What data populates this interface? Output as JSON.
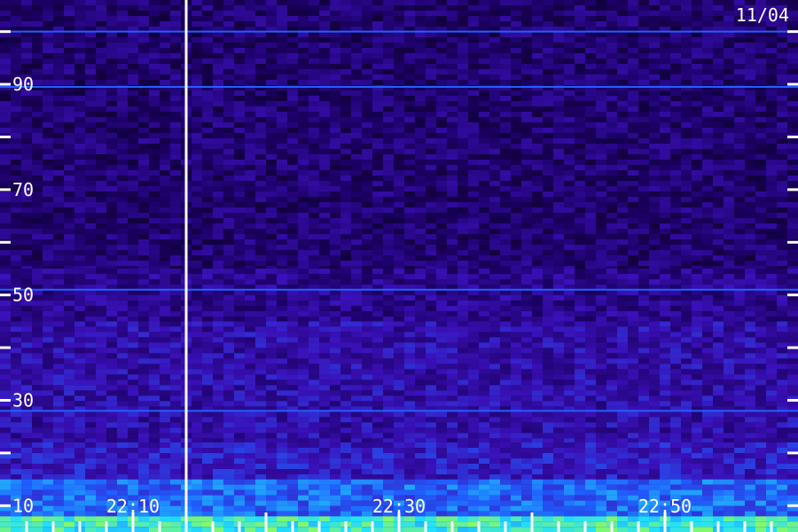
{
  "chart_data": {
    "type": "heatmap",
    "title": "",
    "date_label": "11/04",
    "xlabel": "",
    "ylabel": "",
    "x_time_range": [
      "22:00",
      "23:00"
    ],
    "x_ticks": [
      "22:10",
      "22:30",
      "22:50"
    ],
    "x_minor_tick_minutes": 2,
    "ylim": [
      5,
      106
    ],
    "y_ticks": [
      10,
      30,
      50,
      70,
      90
    ],
    "y_minor_ticks": [
      20,
      40,
      60,
      80,
      100
    ],
    "marker_time": "22:14",
    "grid": false,
    "colormap": [
      "#000000",
      "#1a0060",
      "#3a10b8",
      "#2060ff",
      "#20e0ff",
      "#a0ff40"
    ],
    "bands": [
      {
        "y_from": 5,
        "y_to": 8,
        "intensity": 0.85
      },
      {
        "y_from": 8,
        "y_to": 15,
        "intensity": 0.6
      },
      {
        "y_from": 15,
        "y_to": 22,
        "intensity": 0.42
      },
      {
        "y_from": 22,
        "y_to": 45,
        "intensity": 0.36
      },
      {
        "y_from": 45,
        "y_to": 55,
        "intensity": 0.3
      },
      {
        "y_from": 55,
        "y_to": 106,
        "intensity": 0.24
      }
    ],
    "horizontal_lines": [
      100,
      89.5,
      51,
      28
    ]
  }
}
